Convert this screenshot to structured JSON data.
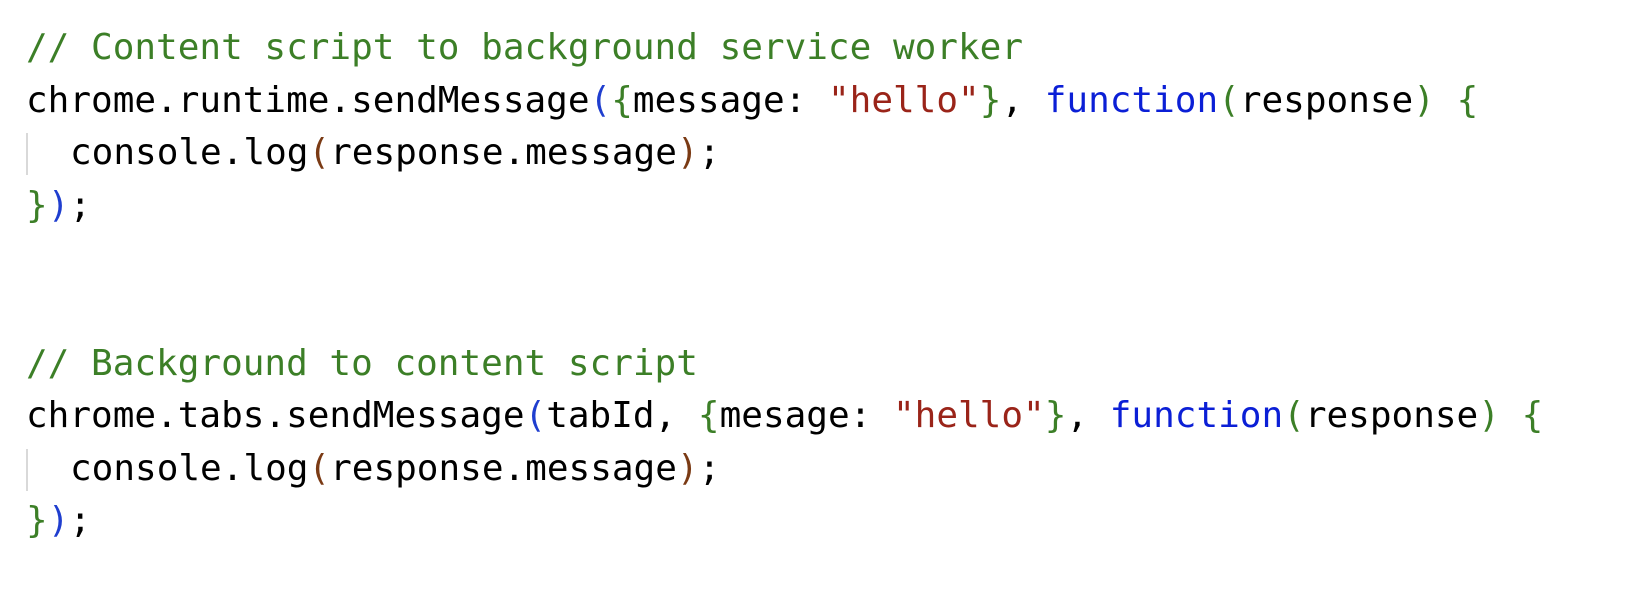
{
  "snippet": {
    "block1": {
      "comment": "// Content script to background service worker",
      "call": "chrome.runtime.sendMessage",
      "object_key": "message: ",
      "string_value": "\"hello\"",
      "keyword": "function",
      "param": "response",
      "body": "console.log",
      "body_arg": "response.message",
      "semicolon": ";"
    },
    "block2": {
      "comment": "// Background to content script",
      "call": "chrome.tabs.sendMessage",
      "first_arg": "tabId, ",
      "object_key": "mesage: ",
      "string_value": "\"hello\"",
      "keyword": "function",
      "param": "response",
      "body": "console.log",
      "body_arg": "response.message",
      "semicolon": ";"
    },
    "punct": {
      "open_paren": "(",
      "close_paren": ")",
      "open_brace": "{",
      "close_brace": "}",
      "comma_space": ", ",
      "space": " "
    }
  },
  "colors": {
    "comment": "#3c7f27",
    "string": "#9a2419",
    "keyword": "#0b1fd6",
    "plain": "#000000"
  }
}
